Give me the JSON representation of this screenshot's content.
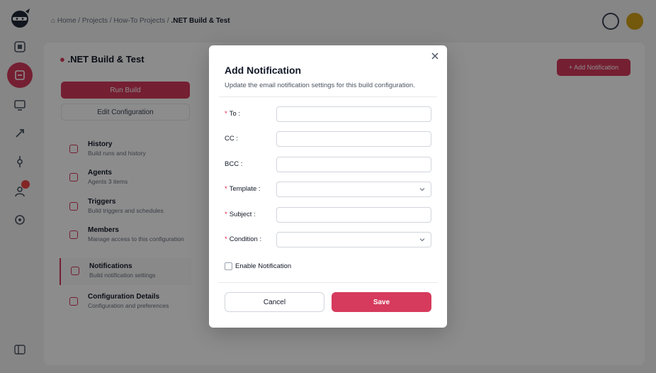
{
  "breadcrumb": {
    "home": "Home",
    "projects": "Projects",
    "project": "How-To Projects",
    "current": ".NET Build & Test",
    "separator": "/"
  },
  "project_panel": {
    "title": ".NET Build & Test",
    "run_label": "Run Build",
    "edit_label": "Edit Configuration",
    "menu": [
      {
        "title": "History",
        "subtitle": "Build runs and history"
      },
      {
        "title": "Agents",
        "subtitle": "Agents 3 items"
      },
      {
        "title": "Triggers",
        "subtitle": "Build triggers and schedules"
      },
      {
        "title": "Members",
        "subtitle": "Manage access to this configuration"
      },
      {
        "title": "Notifications",
        "subtitle": "Build notification settings"
      },
      {
        "title": "Configuration Details",
        "subtitle": "Configuration and preferences"
      }
    ],
    "add_notification_label": "+ Add Notification"
  },
  "modal": {
    "title": "Add Notification",
    "subtitle": "Update the email notification settings for this build configuration.",
    "fields": [
      {
        "label": "To :",
        "required": true,
        "type": "input",
        "value": ""
      },
      {
        "label": "CC :",
        "required": false,
        "type": "input",
        "value": ""
      },
      {
        "label": "BCC :",
        "required": false,
        "type": "input",
        "value": ""
      },
      {
        "label": "Template :",
        "required": true,
        "type": "select",
        "value": ""
      },
      {
        "label": "Subject :",
        "required": true,
        "type": "input",
        "value": ""
      },
      {
        "label": "Condition :",
        "required": true,
        "type": "select",
        "value": ""
      }
    ],
    "required_mark": "*",
    "enable_label": "Enable Notification",
    "enable_checked": false,
    "cancel_label": "Cancel",
    "save_label": "Save"
  },
  "colors": {
    "accent": "#d63a5c",
    "required": "#e11d48",
    "overlay": "rgba(0,0,0,0.45)"
  },
  "icons": {
    "logo": "ninja-logo-icon",
    "close": "close-icon",
    "chevron": "chevron-down-icon"
  }
}
